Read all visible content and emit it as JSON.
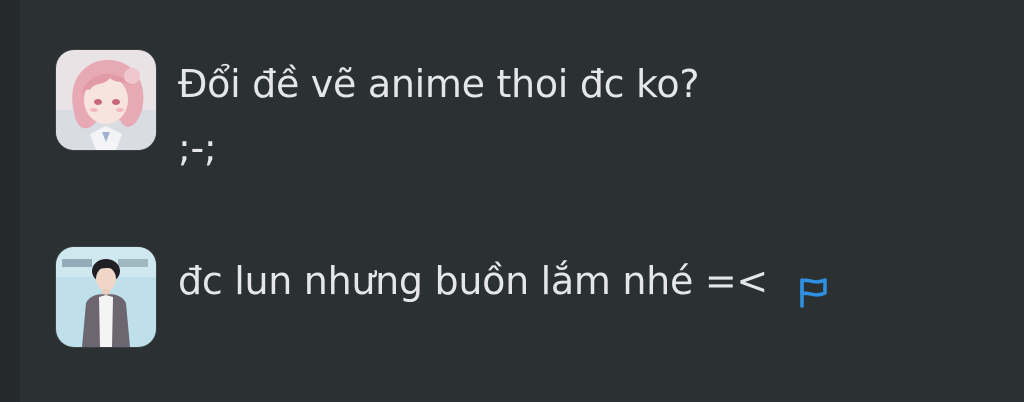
{
  "messages": [
    {
      "avatar_icon": "anime-girl-avatar-icon",
      "lines": [
        "Đổi đề vẽ anime thoi đc ko?",
        ";-;"
      ]
    },
    {
      "avatar_icon": "young-man-avatar-icon",
      "text": "đc lun nhưng buồn lắm nhé =<",
      "action_icon": "report-flag-icon"
    }
  ],
  "colors": {
    "background": "#2b3033",
    "text": "#e4e6e8",
    "accent": "#2f8fe0"
  }
}
